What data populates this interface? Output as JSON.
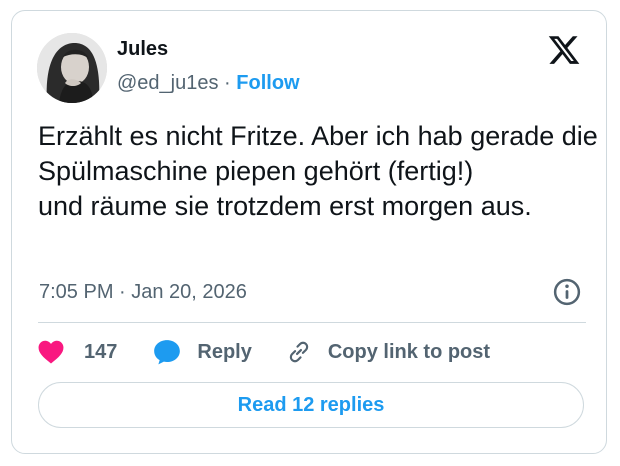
{
  "author": {
    "name": "Jules",
    "handle": "@ed_ju1es",
    "separator": "·",
    "follow_label": "Follow"
  },
  "tweet": {
    "lines": [
      "Erzählt es nicht Fritze. Aber ich hab gerade die Spülmaschine piepen gehört (fertig!)",
      "und räume sie trotzdem erst morgen aus."
    ],
    "timestamp": "7:05 PM · Jan 20, 2026"
  },
  "actions": {
    "like_count": "147",
    "reply_label": "Reply",
    "copy_label": "Copy link to post"
  },
  "footer": {
    "read_replies_label": "Read 12 replies"
  },
  "icons": {
    "brand": "x-logo-icon",
    "info": "info-icon",
    "like": "heart-icon",
    "reply": "speech-bubble-icon",
    "copy": "link-icon"
  },
  "colors": {
    "accent": "#1d9bf0",
    "like": "#f91880",
    "text": "#0f1419",
    "muted": "#536471",
    "border": "#cfd9de"
  }
}
